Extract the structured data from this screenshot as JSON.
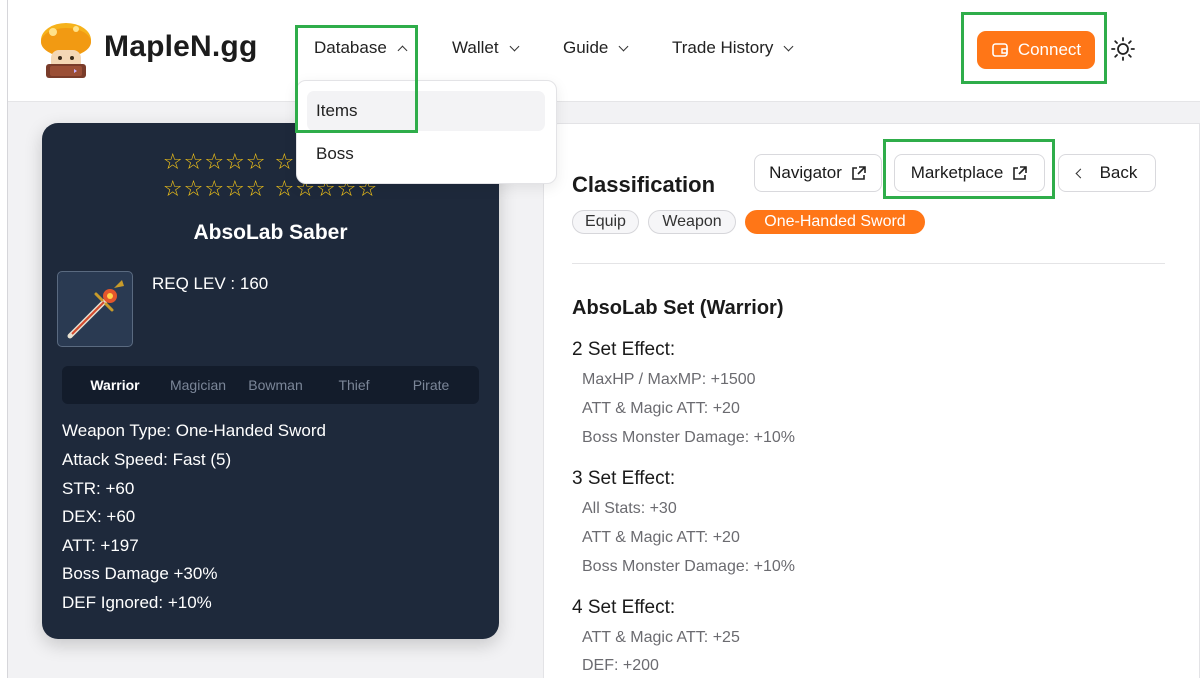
{
  "header": {
    "brand": "MapleN.gg",
    "nav": [
      {
        "label": "Database"
      },
      {
        "label": "Wallet"
      },
      {
        "label": "Guide"
      },
      {
        "label": "Trade History"
      }
    ],
    "connect_label": "Connect",
    "accent_color": "#ff7617",
    "highlight_color": "#2fad4a"
  },
  "dropdown": {
    "items": [
      {
        "label": "Items",
        "active": true
      },
      {
        "label": "Boss",
        "active": false
      }
    ]
  },
  "item_card": {
    "star_rows": [
      "☆☆☆☆☆ ☆☆☆☆☆",
      "☆☆☆☆☆ ☆☆☆☆☆"
    ],
    "name": "AbsoLab Saber",
    "req_level": "REQ LEV : 160",
    "jobs": [
      {
        "label": "Warrior",
        "active": true
      },
      {
        "label": "Magician",
        "active": false
      },
      {
        "label": "Bowman",
        "active": false
      },
      {
        "label": "Thief",
        "active": false
      },
      {
        "label": "Pirate",
        "active": false
      }
    ],
    "stats": [
      "Weapon Type: One-Handed Sword",
      "Attack Speed: Fast (5)",
      "STR: +60",
      "DEX: +60",
      "ATT: +197",
      "Boss Damage +30%",
      "DEF Ignored: +10%"
    ]
  },
  "detail": {
    "classification_title": "Classification",
    "buttons": {
      "navigator": "Navigator",
      "marketplace": "Marketplace",
      "back": "Back"
    },
    "tags": [
      "Equip",
      "Weapon",
      "One-Handed Sword"
    ],
    "set_title": "AbsoLab Set (Warrior)",
    "set_effects": [
      {
        "heading": "2 Set Effect:",
        "lines": [
          "MaxHP / MaxMP: +1500",
          "ATT & Magic ATT: +20",
          "Boss Monster Damage: +10%"
        ]
      },
      {
        "heading": "3 Set Effect:",
        "lines": [
          "All Stats: +30",
          "ATT & Magic ATT: +20",
          "Boss Monster Damage: +10%"
        ]
      },
      {
        "heading": "4 Set Effect:",
        "lines": [
          "ATT & Magic ATT: +25",
          "DEF: +200"
        ]
      }
    ]
  }
}
